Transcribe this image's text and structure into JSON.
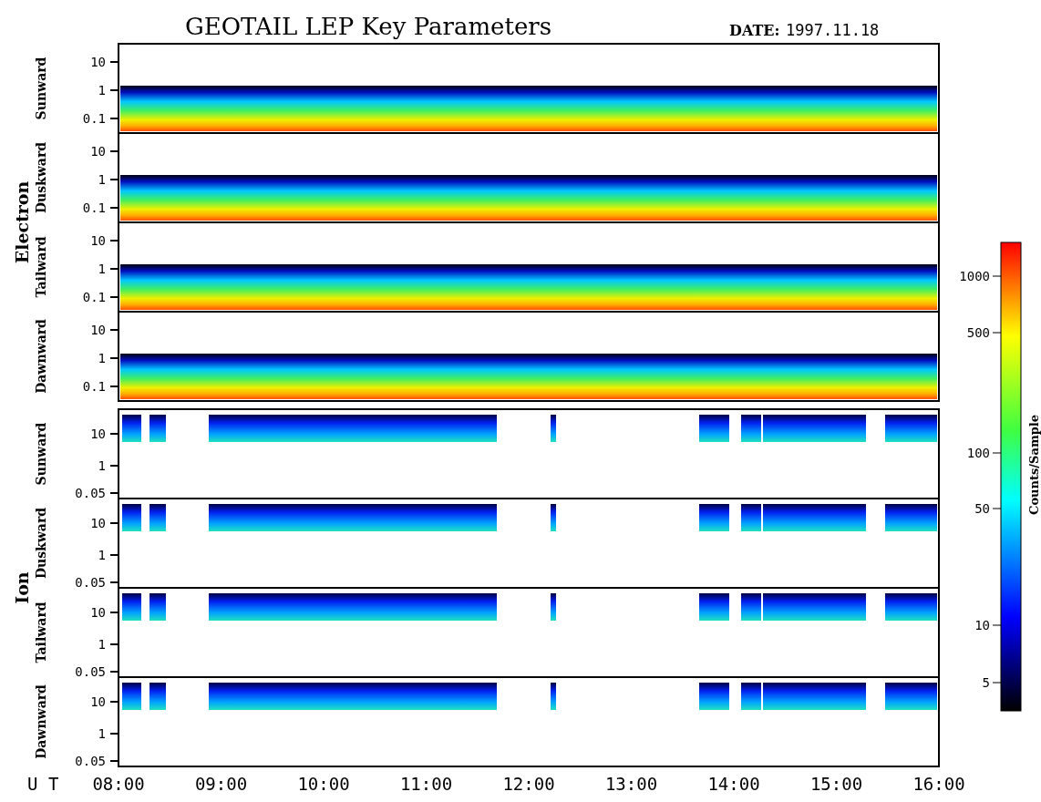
{
  "title": "GEOTAIL LEP Key Parameters",
  "date": {
    "label": "DATE:",
    "value": "1997.11.18"
  },
  "groups": [
    {
      "kind": "electron",
      "name": "Electron",
      "panels": [
        {
          "direction": "Sunward",
          "ticks": [
            "10",
            "1",
            "0.1"
          ]
        },
        {
          "direction": "Duskward",
          "ticks": [
            "10",
            "1",
            "0.1"
          ]
        },
        {
          "direction": "Tailward",
          "ticks": [
            "10",
            "1",
            "0.1"
          ]
        },
        {
          "direction": "Dawnward",
          "ticks": [
            "10",
            "1",
            "0.1"
          ]
        }
      ]
    },
    {
      "kind": "ion",
      "name": "Ion",
      "panels": [
        {
          "direction": "Sunward",
          "ticks": [
            "10",
            "1",
            "0.05"
          ]
        },
        {
          "direction": "Duskward",
          "ticks": [
            "10",
            "1",
            "0.05"
          ]
        },
        {
          "direction": "Tailward",
          "ticks": [
            "10",
            "1",
            "0.05"
          ]
        },
        {
          "direction": "Dawnward",
          "ticks": [
            "10",
            "1",
            "0.05"
          ]
        }
      ]
    }
  ],
  "colorbar": {
    "label": "Counts/Sample",
    "ticks": [
      "1000",
      "500",
      "100",
      "50",
      "10",
      "5"
    ]
  },
  "time_axis": {
    "label": "U T",
    "ticks": [
      "08:00",
      "09:00",
      "10:00",
      "11:00",
      "12:00",
      "13:00",
      "14:00",
      "15:00",
      "16:00"
    ]
  }
}
